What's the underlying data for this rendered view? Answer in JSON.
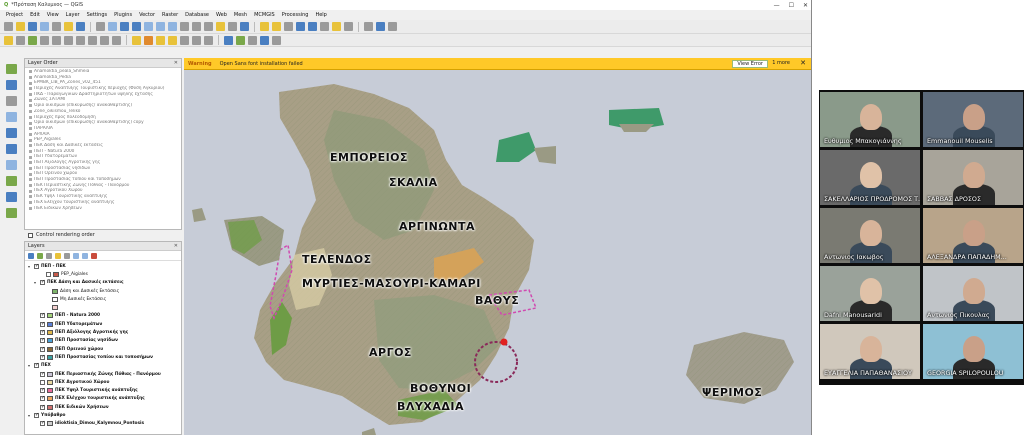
{
  "window": {
    "title": "*Πρόταση Καλυμνος — QGIS"
  },
  "menu": [
    "Project",
    "Edit",
    "View",
    "Layer",
    "Settings",
    "Plugins",
    "Vector",
    "Raster",
    "Database",
    "Web",
    "Mesh",
    "MCMGIS",
    "Processing",
    "Help"
  ],
  "layer_order": {
    "title": "Layer Order",
    "items": [
      "Anamoktia_peala_Shmeia",
      "Anamoktia_Pedia",
      "EPMBK_LIB_PA_Zones_v02_451",
      "Περιοχές Αναπτυξης Τουριστικής περιοχής (Φύση Αγκυρίου)",
      "ΠΚΔ - Παραγωγικών Δραστηριοτήτων υψηλής έχτασης",
      "Ζώνες ΣΑΤΑΜΙ",
      "Όριο οικισμών (επικύρωσης/ ανακαθάρτισης)",
      "Zone_oikismou_Telikó",
      "Περιοχές προς πολεοδόμηση",
      "Όριο οικισμών (επικύρωσης/ ανακαθάρτισης) copy",
      "ΠΑΡΑΛΙΑ",
      "ΑΡΧΑΙΑ",
      "PEP_Aigiales",
      "ΠΕΚ Δάση και Δασικές εκτάσεις",
      "ΠΕΠ - Natura 2000",
      "ΠΕΠ Υδατορεμάτων",
      "ΠΕΠ Αξιόλογης Αγροτικής γης",
      "ΠΕΠ Προστασίας νησίδων",
      "ΠΕΠ Ορεινού χώρου",
      "ΠΕΠ Προστασίας τοπίου και τοποσήμων",
      "ΠΕΚ Περιαστικής Ζώνης Πόθιας - Πανόρμου",
      "ΠΕΧ Αγροτικού Χώρου",
      "ΠΕΚ Υψηλ Τουριστικής ανάπτυξης",
      "ΠΕΧ Ελέγχου τουριστικής ανάπτυξης",
      "ΠΕΚ Ειδικών Χρήσεων"
    ]
  },
  "control_rendering": "Control rendering order",
  "layers_panel": {
    "title": "Layers",
    "rows": [
      {
        "label": "ΠΕΠ - ΠΕΚ",
        "checked": true,
        "indent": 0,
        "swatch": "",
        "expand": "▾"
      },
      {
        "label": "PEP_Aigiales",
        "checked": false,
        "indent": 2,
        "swatch": "#c85a4a",
        "expand": ""
      },
      {
        "label": "ΠΕΚ Δάση και Δασικές εκτάσεις",
        "checked": true,
        "indent": 1,
        "swatch": "",
        "expand": "▾"
      },
      {
        "label": "Δάση και Δασικές Εκτάσεις",
        "checked": false,
        "indent": 3,
        "swatch": "#7db56a",
        "expand": ""
      },
      {
        "label": "Μη Δασικές Εκτάσεις",
        "checked": false,
        "indent": 3,
        "swatch": "#ffffff",
        "expand": ""
      },
      {
        "label": "",
        "checked": false,
        "indent": 3,
        "swatch": "#f4d0d0",
        "expand": ""
      },
      {
        "label": "ΠΕΠ - Natura 2000",
        "checked": true,
        "indent": 1,
        "swatch": "#a3d37a",
        "expand": ""
      },
      {
        "label": "ΠΕΠ Υδατορεμάτων",
        "checked": true,
        "indent": 1,
        "swatch": "#5a7fd6",
        "expand": ""
      },
      {
        "label": "ΠΕΠ Αξιόλογης Αγροτικής γης",
        "checked": true,
        "indent": 1,
        "swatch": "#e0b84a",
        "expand": ""
      },
      {
        "label": "ΠΕΠ Προστασίας νησίδων",
        "checked": true,
        "indent": 1,
        "swatch": "#4aa0d6",
        "expand": ""
      },
      {
        "label": "ΠΕΠ Ορεινού χώρου",
        "checked": true,
        "indent": 1,
        "swatch": "#8a6a3a",
        "expand": ""
      },
      {
        "label": "ΠΕΠ Προστασίας τοπίου και τοποσήμων",
        "checked": true,
        "indent": 1,
        "swatch": "#3aa0a0",
        "expand": ""
      },
      {
        "label": "ΠΕΧ",
        "checked": true,
        "indent": 0,
        "swatch": "",
        "expand": "▾"
      },
      {
        "label": "ΠΕΚ Περιαστικής Ζώνης Πόθιας - Πανόρμου",
        "checked": true,
        "indent": 1,
        "swatch": "#c9c4d6",
        "expand": ""
      },
      {
        "label": "ΠΕΧ Αγροτικού Χώρου",
        "checked": false,
        "indent": 1,
        "swatch": "#e8d8a0",
        "expand": ""
      },
      {
        "label": "ΠΕΚ Υψηλ Τουριστικής ανάπτυξης",
        "checked": true,
        "indent": 1,
        "swatch": "#e86a9a",
        "expand": ""
      },
      {
        "label": "ΠΕΧ Ελέγχου τουριστικής ανάπτυξης",
        "checked": true,
        "indent": 1,
        "swatch": "#f0a860",
        "expand": ""
      },
      {
        "label": "ΠΕΚ Ειδικών Χρήσεων",
        "checked": true,
        "indent": 1,
        "swatch": "#d07070",
        "expand": ""
      },
      {
        "label": "Υπόβαθρο",
        "checked": true,
        "indent": 0,
        "swatch": "",
        "expand": "▾"
      },
      {
        "label": "idioktisia_Dimou_Kalymnou_Pontosis",
        "checked": true,
        "indent": 1,
        "swatch": "#cfcfcf",
        "expand": ""
      }
    ]
  },
  "message_bar": {
    "level": "Warning",
    "text": "Open Sans font installation failed",
    "button": "View Error",
    "more": "1 more",
    "close": "✕"
  },
  "map": {
    "sea_color": "#c7ccd7",
    "labels": [
      {
        "text": "ΕΜΠΟΡΕΙΟΣ",
        "size": 11
      },
      {
        "text": "ΣΚΑΛΙΑ",
        "size": 11
      },
      {
        "text": "ΑΡΓΙΝΩΝΤΑ",
        "size": 11
      },
      {
        "text": "ΤΕΛΕΝΔΟΣ",
        "size": 11
      },
      {
        "text": "ΜΥΡΤΙΕΣ-ΜΑΣΟΥΡΙ-ΚΑΜΑΡΙ",
        "size": 11
      },
      {
        "text": "ΒΑΘΥΣ",
        "size": 11
      },
      {
        "text": "ΑΡΓΟΣ",
        "size": 11
      },
      {
        "text": "ΒΟΘΥΝΟΙ",
        "size": 11
      },
      {
        "text": "ΒΛΥΧΑΔΙΑ",
        "size": 11
      },
      {
        "text": "ΨΕΡΙΜΟΣ",
        "size": 11
      }
    ]
  },
  "video_call": {
    "participants": [
      {
        "name": "Ευθυμιος Μπακογιάννης",
        "bg": "#8a9a8a"
      },
      {
        "name": "Emmanouil Mouselis",
        "bg": "#5c6a7a"
      },
      {
        "name": "ΣΑΚΕΛΛΑΡΙΟΣ ΠΡΟΔΡΟΜΟΣ Τ...",
        "bg": "#6a6a6a"
      },
      {
        "name": "ΣΑΒΒΑΣ ΔΡΟΣΟΣ",
        "bg": "#a8a49a"
      },
      {
        "name": "Αντωνιος Ιακωβος",
        "bg": "#7a7a72"
      },
      {
        "name": "ΑΛΕΞΑΝΔΡΑ ΠΑΠΑΔΗΜ...",
        "bg": "#b8a48a"
      },
      {
        "name": "Dafni Manousaridi",
        "bg": "#9aa29a"
      },
      {
        "name": "Αντωνιος Πικουλας",
        "bg": "#c0c4c8"
      },
      {
        "name": "ΕΥΑΓΓΕΛΙΑ ΠΑΠΑΘΑΝΑΣΙΟΥ",
        "bg": "#d0c8bc"
      },
      {
        "name": "GEORGIA SPILOPOULOU",
        "bg": "#8ec0d4"
      }
    ]
  }
}
